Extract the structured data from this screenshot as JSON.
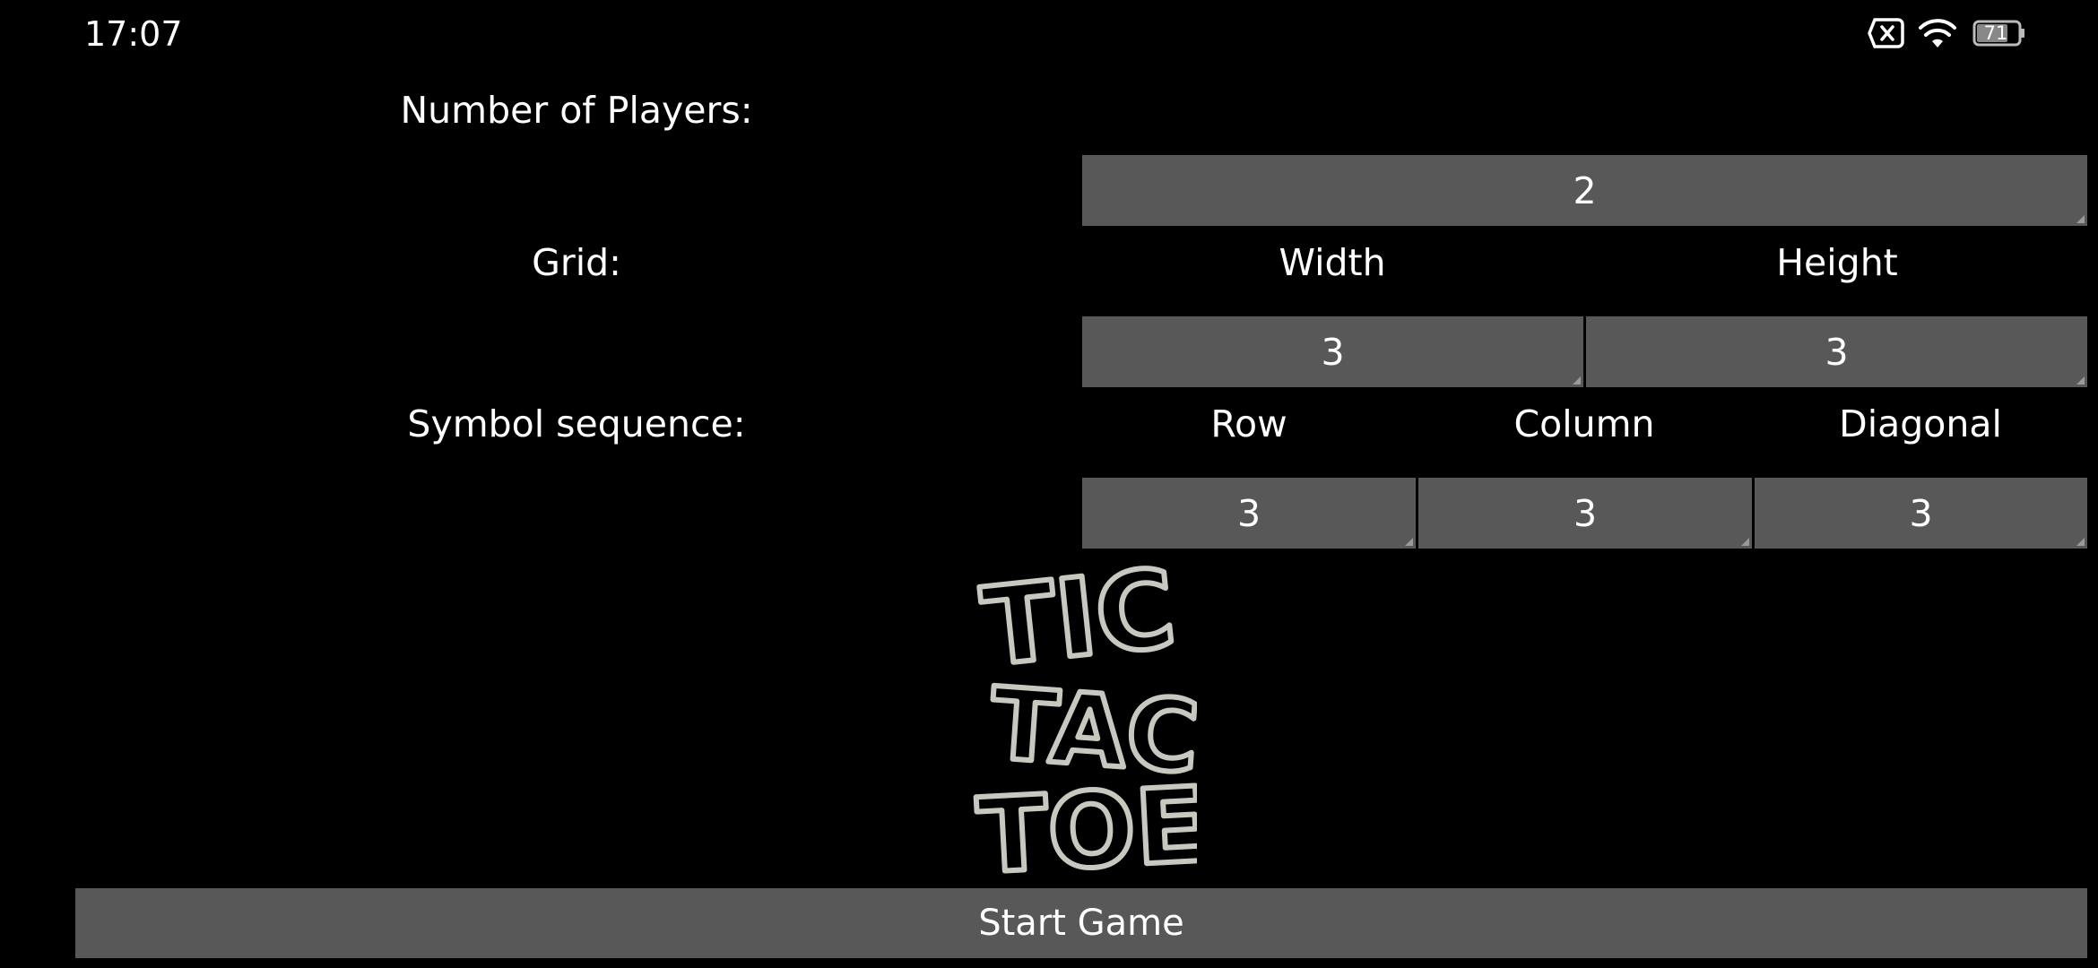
{
  "status_bar": {
    "time": "17:07",
    "battery_level": "71",
    "icons": [
      "sim-blocked-icon",
      "wifi-icon",
      "battery-icon"
    ]
  },
  "players": {
    "label": "Number of Players:",
    "value": "2"
  },
  "grid": {
    "label": "Grid:",
    "width_label": "Width",
    "height_label": "Height",
    "width_value": "3",
    "height_value": "3"
  },
  "sequence": {
    "label": "Symbol sequence:",
    "row_label": "Row",
    "column_label": "Column",
    "diagonal_label": "Diagonal",
    "row_value": "3",
    "column_value": "3",
    "diagonal_value": "3"
  },
  "logo": {
    "name": "tic-tac-toe-logo",
    "lines": [
      "TIC",
      "TAC",
      "TOE"
    ]
  },
  "start_button": {
    "label": "Start Game"
  },
  "colors": {
    "background": "#000000",
    "field": "#585858",
    "text": "#ffffff",
    "logo_outline": "#c8c8c0"
  }
}
